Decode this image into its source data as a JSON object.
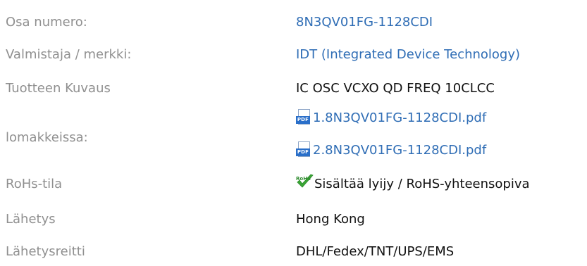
{
  "rows": [
    {
      "label": "Osa numero:",
      "value": "8N3QV01FG-1128CDI"
    },
    {
      "label": "Valmistaja / merkki:",
      "value": "IDT (Integrated Device Technology)"
    },
    {
      "label": "Tuotteen Kuvaus",
      "value": "IC OSC VCXO QD FREQ 10CLCC"
    },
    {
      "label": "lomakkeissa:",
      "files": [
        "1.8N3QV01FG-1128CDI.pdf",
        "2.8N3QV01FG-1128CDI.pdf"
      ],
      "file_icon": "pdf-icon",
      "file_icon_text": "PDF"
    },
    {
      "label": "RoHs-tila",
      "value": "Sisältää lyijy / RoHS-yhteensopiva",
      "icon": "rohs-check-icon",
      "icon_text": "RoHS"
    },
    {
      "label": "Lähetys",
      "value": "Hong Kong"
    },
    {
      "label": "Lähetysreitti",
      "value": "DHL/Fedex/TNT/UPS/EMS"
    }
  ],
  "colors": {
    "label": "#909090",
    "link": "#2f6db5",
    "text": "#111111",
    "check": "#3aa635"
  }
}
